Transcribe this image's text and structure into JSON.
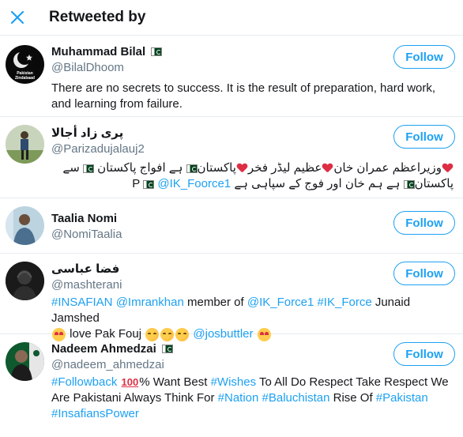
{
  "header": {
    "title": "Retweeted by",
    "close_icon": "close-icon"
  },
  "follow_label": "Follow",
  "colors": {
    "accent": "#1da1f2",
    "text": "#14171a",
    "secondary": "#657786",
    "divider": "#e6ecf0"
  },
  "users": [
    {
      "name": "Muhammad Bilal",
      "handle": "@BilalDhoom",
      "avatar_text": "Pakistan Zindabaad",
      "bio": "There are no secrets to success. It is the result of preparation, hard work, and learning from failure."
    },
    {
      "name": "پری زاد أجالا",
      "handle": "@Parizadujalauj2",
      "bio_line1_parts": [
        "وزیراعظم عمران خان",
        "عظیم لیڈر فخر",
        "پاکستان",
        "ہے افواج پاکستان",
        "سے"
      ],
      "bio_line2_parts": [
        "پاکستان",
        "ہے ہم خان اور فوج کے سپاہی ہے",
        "P",
        "@IK_Foorce1"
      ]
    },
    {
      "name": "Taalia Nomi",
      "handle": "@NomiTaalia"
    },
    {
      "name": "فضا عباسی",
      "handle": "@mashterani",
      "bio_line1": {
        "link1": "#INSAFIAN",
        "link2": "@Imrankhan",
        "text1": "member of",
        "link3": "@IK_Force1",
        "link4": "#IK_Force",
        "text2": "Junaid Jamshed"
      },
      "bio_line2": {
        "text": "love Pak Fouj",
        "link": "@josbuttler"
      }
    },
    {
      "name": "Nadeem Ahmedzai",
      "handle": "@nadeem_ahmedzai",
      "bio": {
        "link1": "#Followback",
        "hundred": "100",
        "text1": "% Want Best",
        "link2": "#Wishes",
        "text2": "To All Do Respect Take Respect We Are Pakistani Always Think For",
        "link3": "#Nation",
        "link4": "#Baluchistan",
        "text3": "Rise Of",
        "link5": "#Pakistan",
        "link6": "#InsafiansPower"
      }
    }
  ]
}
